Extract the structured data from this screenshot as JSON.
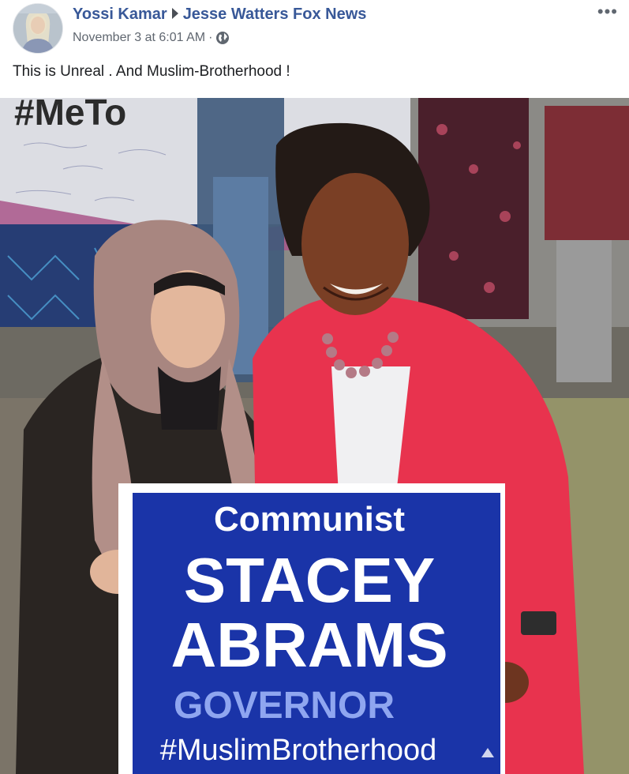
{
  "post": {
    "author": "Yossi Kamar",
    "target": "Jesse Watters Fox News",
    "timestamp": "November 3 at 6:01 AM",
    "separator": "·",
    "privacy_icon": "globe-icon",
    "more_icon": "more-options-icon",
    "more_label": "•••",
    "text": "This is Unreal . And Muslim-Brotherhood !"
  },
  "photo": {
    "background_sign": "#MeTo",
    "sign": {
      "line1": "Communist",
      "line2": "STACEY",
      "line3": "ABRAMS",
      "line4": "GOVERNOR",
      "line5": "#MuslimBrotherhood"
    }
  },
  "colors": {
    "link": "#385898",
    "meta": "#606770",
    "sign_blue": "#1a34a8",
    "sign_light_blue": "#8fa6f0",
    "cardigan": "#e8334e"
  }
}
